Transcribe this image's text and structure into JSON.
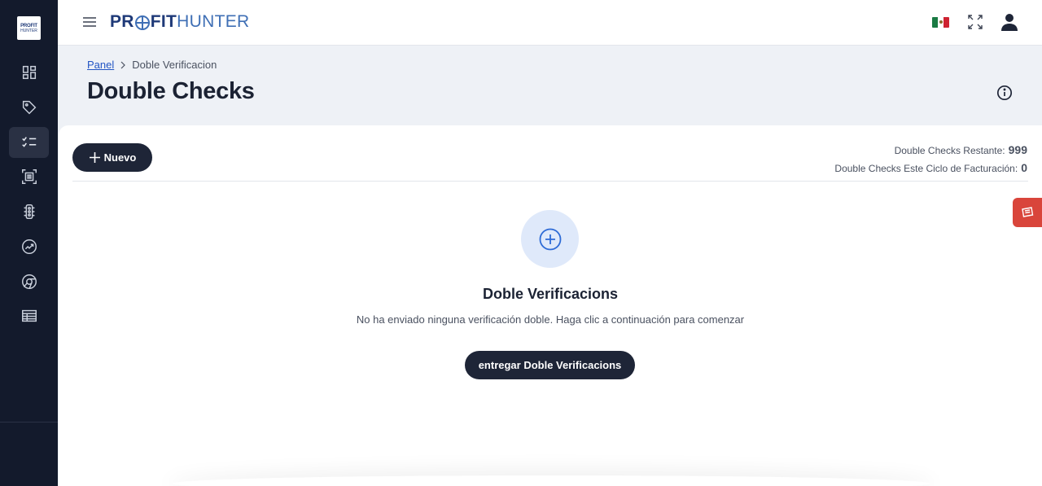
{
  "app": {
    "logo_line1": "PROFIT",
    "logo_line2": "HUNTER",
    "brand_bold_1": "PR",
    "brand_bold_2": "FIT",
    "brand_light": "HUNTER"
  },
  "sidebar": {
    "items": [
      {
        "icon": "dashboard-icon"
      },
      {
        "icon": "tag-icon"
      },
      {
        "icon": "checklist-icon",
        "active": true
      },
      {
        "icon": "scan-icon"
      },
      {
        "icon": "traffic-light-icon"
      },
      {
        "icon": "chart-icon"
      },
      {
        "icon": "chrome-icon"
      },
      {
        "icon": "table-icon"
      }
    ]
  },
  "header": {
    "language_flag": "mexico-flag-icon"
  },
  "breadcrumb": {
    "root": "Panel",
    "current": "Doble Verificacion"
  },
  "page": {
    "title": "Double Checks"
  },
  "toolbar": {
    "new_label": "Nuevo"
  },
  "stats": {
    "remaining_label": "Double Checks Restante:",
    "remaining_value": "999",
    "cycle_label": "Double Checks Este Ciclo de Facturación:",
    "cycle_value": "0"
  },
  "empty_state": {
    "title": "Doble Verificacions",
    "text": "No ha enviado ninguna verificación doble. Haga clic a continuación para comenzar",
    "button_label": "entregar Doble Verificacions"
  },
  "colors": {
    "sidebar_bg": "#131a2c",
    "primary_button": "#1e2537",
    "brand_dark": "#1f3a78",
    "brand_light": "#3f6fb5",
    "feedback": "#d9453b"
  }
}
